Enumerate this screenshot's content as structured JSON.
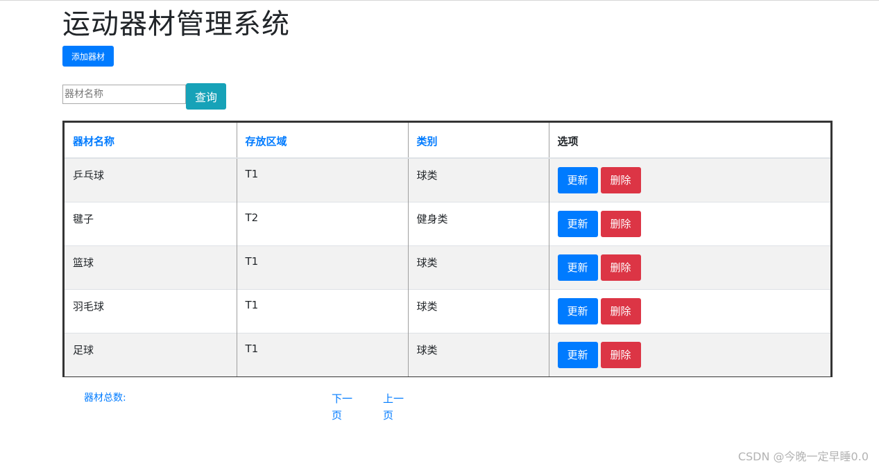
{
  "header": {
    "title": "运动器材管理系统"
  },
  "toolbar": {
    "add_label": "添加器材"
  },
  "search": {
    "placeholder": "器材名称",
    "value": "",
    "button_label": "查询"
  },
  "table": {
    "columns": [
      "器材名称",
      "存放区域",
      "类别",
      "选项"
    ],
    "rows": [
      {
        "name": "乒乓球",
        "area": "T1",
        "category": "球类"
      },
      {
        "name": "毽子",
        "area": "T2",
        "category": "健身类"
      },
      {
        "name": "篮球",
        "area": "T1",
        "category": "球类"
      },
      {
        "name": "羽毛球",
        "area": "T1",
        "category": "球类"
      },
      {
        "name": "足球",
        "area": "T1",
        "category": "球类"
      }
    ],
    "update_label": "更新",
    "delete_label": "删除"
  },
  "footer": {
    "total_label": "器材总数:",
    "next_label": "下一页",
    "prev_label": "上一页"
  },
  "watermark": "CSDN @今晚一定早睡0.0",
  "colors": {
    "primary": "#007bff",
    "info": "#17a2b8",
    "danger": "#dc3545",
    "stripe": "#f2f2f2"
  }
}
